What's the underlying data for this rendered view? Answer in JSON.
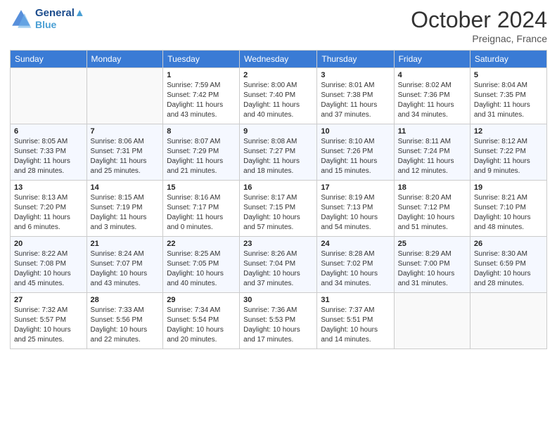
{
  "header": {
    "logo_line1": "General",
    "logo_line2": "Blue",
    "month": "October 2024",
    "location": "Preignac, France"
  },
  "days_of_week": [
    "Sunday",
    "Monday",
    "Tuesday",
    "Wednesday",
    "Thursday",
    "Friday",
    "Saturday"
  ],
  "weeks": [
    [
      {
        "num": "",
        "sunrise": "",
        "sunset": "",
        "daylight": ""
      },
      {
        "num": "",
        "sunrise": "",
        "sunset": "",
        "daylight": ""
      },
      {
        "num": "1",
        "sunrise": "Sunrise: 7:59 AM",
        "sunset": "Sunset: 7:42 PM",
        "daylight": "Daylight: 11 hours and 43 minutes."
      },
      {
        "num": "2",
        "sunrise": "Sunrise: 8:00 AM",
        "sunset": "Sunset: 7:40 PM",
        "daylight": "Daylight: 11 hours and 40 minutes."
      },
      {
        "num": "3",
        "sunrise": "Sunrise: 8:01 AM",
        "sunset": "Sunset: 7:38 PM",
        "daylight": "Daylight: 11 hours and 37 minutes."
      },
      {
        "num": "4",
        "sunrise": "Sunrise: 8:02 AM",
        "sunset": "Sunset: 7:36 PM",
        "daylight": "Daylight: 11 hours and 34 minutes."
      },
      {
        "num": "5",
        "sunrise": "Sunrise: 8:04 AM",
        "sunset": "Sunset: 7:35 PM",
        "daylight": "Daylight: 11 hours and 31 minutes."
      }
    ],
    [
      {
        "num": "6",
        "sunrise": "Sunrise: 8:05 AM",
        "sunset": "Sunset: 7:33 PM",
        "daylight": "Daylight: 11 hours and 28 minutes."
      },
      {
        "num": "7",
        "sunrise": "Sunrise: 8:06 AM",
        "sunset": "Sunset: 7:31 PM",
        "daylight": "Daylight: 11 hours and 25 minutes."
      },
      {
        "num": "8",
        "sunrise": "Sunrise: 8:07 AM",
        "sunset": "Sunset: 7:29 PM",
        "daylight": "Daylight: 11 hours and 21 minutes."
      },
      {
        "num": "9",
        "sunrise": "Sunrise: 8:08 AM",
        "sunset": "Sunset: 7:27 PM",
        "daylight": "Daylight: 11 hours and 18 minutes."
      },
      {
        "num": "10",
        "sunrise": "Sunrise: 8:10 AM",
        "sunset": "Sunset: 7:26 PM",
        "daylight": "Daylight: 11 hours and 15 minutes."
      },
      {
        "num": "11",
        "sunrise": "Sunrise: 8:11 AM",
        "sunset": "Sunset: 7:24 PM",
        "daylight": "Daylight: 11 hours and 12 minutes."
      },
      {
        "num": "12",
        "sunrise": "Sunrise: 8:12 AM",
        "sunset": "Sunset: 7:22 PM",
        "daylight": "Daylight: 11 hours and 9 minutes."
      }
    ],
    [
      {
        "num": "13",
        "sunrise": "Sunrise: 8:13 AM",
        "sunset": "Sunset: 7:20 PM",
        "daylight": "Daylight: 11 hours and 6 minutes."
      },
      {
        "num": "14",
        "sunrise": "Sunrise: 8:15 AM",
        "sunset": "Sunset: 7:19 PM",
        "daylight": "Daylight: 11 hours and 3 minutes."
      },
      {
        "num": "15",
        "sunrise": "Sunrise: 8:16 AM",
        "sunset": "Sunset: 7:17 PM",
        "daylight": "Daylight: 11 hours and 0 minutes."
      },
      {
        "num": "16",
        "sunrise": "Sunrise: 8:17 AM",
        "sunset": "Sunset: 7:15 PM",
        "daylight": "Daylight: 10 hours and 57 minutes."
      },
      {
        "num": "17",
        "sunrise": "Sunrise: 8:19 AM",
        "sunset": "Sunset: 7:13 PM",
        "daylight": "Daylight: 10 hours and 54 minutes."
      },
      {
        "num": "18",
        "sunrise": "Sunrise: 8:20 AM",
        "sunset": "Sunset: 7:12 PM",
        "daylight": "Daylight: 10 hours and 51 minutes."
      },
      {
        "num": "19",
        "sunrise": "Sunrise: 8:21 AM",
        "sunset": "Sunset: 7:10 PM",
        "daylight": "Daylight: 10 hours and 48 minutes."
      }
    ],
    [
      {
        "num": "20",
        "sunrise": "Sunrise: 8:22 AM",
        "sunset": "Sunset: 7:08 PM",
        "daylight": "Daylight: 10 hours and 45 minutes."
      },
      {
        "num": "21",
        "sunrise": "Sunrise: 8:24 AM",
        "sunset": "Sunset: 7:07 PM",
        "daylight": "Daylight: 10 hours and 43 minutes."
      },
      {
        "num": "22",
        "sunrise": "Sunrise: 8:25 AM",
        "sunset": "Sunset: 7:05 PM",
        "daylight": "Daylight: 10 hours and 40 minutes."
      },
      {
        "num": "23",
        "sunrise": "Sunrise: 8:26 AM",
        "sunset": "Sunset: 7:04 PM",
        "daylight": "Daylight: 10 hours and 37 minutes."
      },
      {
        "num": "24",
        "sunrise": "Sunrise: 8:28 AM",
        "sunset": "Sunset: 7:02 PM",
        "daylight": "Daylight: 10 hours and 34 minutes."
      },
      {
        "num": "25",
        "sunrise": "Sunrise: 8:29 AM",
        "sunset": "Sunset: 7:00 PM",
        "daylight": "Daylight: 10 hours and 31 minutes."
      },
      {
        "num": "26",
        "sunrise": "Sunrise: 8:30 AM",
        "sunset": "Sunset: 6:59 PM",
        "daylight": "Daylight: 10 hours and 28 minutes."
      }
    ],
    [
      {
        "num": "27",
        "sunrise": "Sunrise: 7:32 AM",
        "sunset": "Sunset: 5:57 PM",
        "daylight": "Daylight: 10 hours and 25 minutes."
      },
      {
        "num": "28",
        "sunrise": "Sunrise: 7:33 AM",
        "sunset": "Sunset: 5:56 PM",
        "daylight": "Daylight: 10 hours and 22 minutes."
      },
      {
        "num": "29",
        "sunrise": "Sunrise: 7:34 AM",
        "sunset": "Sunset: 5:54 PM",
        "daylight": "Daylight: 10 hours and 20 minutes."
      },
      {
        "num": "30",
        "sunrise": "Sunrise: 7:36 AM",
        "sunset": "Sunset: 5:53 PM",
        "daylight": "Daylight: 10 hours and 17 minutes."
      },
      {
        "num": "31",
        "sunrise": "Sunrise: 7:37 AM",
        "sunset": "Sunset: 5:51 PM",
        "daylight": "Daylight: 10 hours and 14 minutes."
      },
      {
        "num": "",
        "sunrise": "",
        "sunset": "",
        "daylight": ""
      },
      {
        "num": "",
        "sunrise": "",
        "sunset": "",
        "daylight": ""
      }
    ]
  ]
}
